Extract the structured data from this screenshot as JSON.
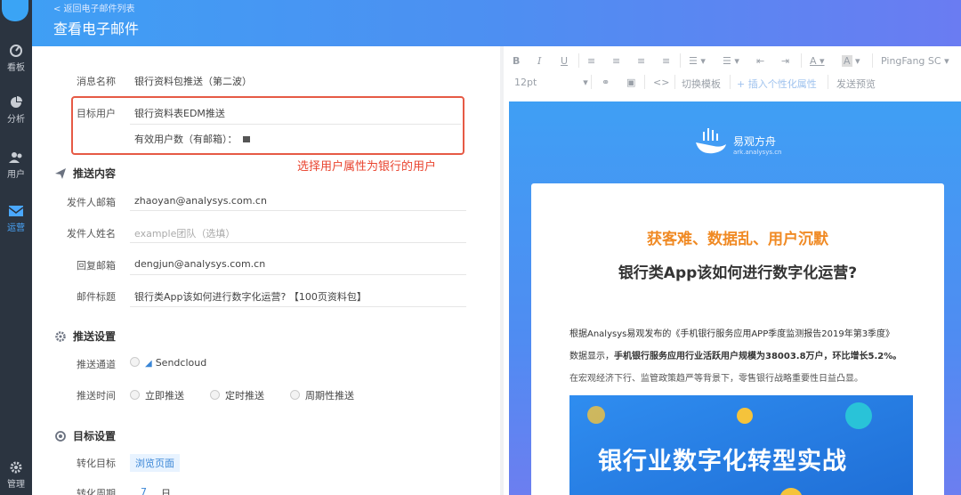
{
  "nav": {
    "items": [
      {
        "label": "看板",
        "icon": "dashboard-icon"
      },
      {
        "label": "分析",
        "icon": "pie-chart-icon"
      },
      {
        "label": "用户",
        "icon": "users-icon"
      },
      {
        "label": "运营",
        "icon": "mail-icon"
      },
      {
        "label": "管理",
        "icon": "gear-icon"
      }
    ]
  },
  "header": {
    "back_link": "< 返回电子邮件列表",
    "title": "查看电子邮件"
  },
  "form": {
    "message_name_label": "消息名称",
    "message_name_value": "银行资料包推送（第二波）",
    "target_users_label": "目标用户",
    "target_users_value": "银行资料表EDM推送",
    "valid_users_label": "有效用户数（有邮箱）：",
    "annotation": "选择用户属性为银行的用户",
    "push_content_title": "推送内容",
    "sender_email_label": "发件人邮箱",
    "sender_email_value": "zhaoyan@analysys.com.cn",
    "sender_name_label": "发件人姓名",
    "sender_name_placeholder": "example团队（选填）",
    "reply_email_label": "回复邮箱",
    "reply_email_value": "dengjun@analysys.com.cn",
    "subject_label": "邮件标题",
    "subject_value": "银行类App该如何进行数字化运营? 【100页资料包】",
    "push_settings_title": "推送设置",
    "channel_label": "推送通道",
    "channel_value": "Sendcloud",
    "time_label": "推送时间",
    "time_options": [
      "立即推送",
      "定时推送",
      "周期性推送"
    ],
    "target_settings_title": "目标设置",
    "conversion_target_label": "转化目标",
    "conversion_target_value": "浏览页面",
    "conversion_period_label": "转化周期",
    "conversion_period_value": "7",
    "conversion_period_unit": "日"
  },
  "editor": {
    "toolbar": {
      "bold": "B",
      "italic": "I",
      "underline": "U",
      "font_family": "PingFang SC",
      "font_size": "12pt",
      "switch_template": "切换模板",
      "insert_attr": "+ 插入个性化属性",
      "send_preview": "发送预览",
      "code": "<>"
    },
    "preview": {
      "brand_name": "易观方舟",
      "brand_url": "ark.analysys.cn",
      "headline": "获客难、数据乱、用户沉默",
      "subheadline": "银行类App该如何进行数字化运营?",
      "para1": "根据Analysys易观发布的《手机银行服务应用APP季度监测报告2019年第3季度》",
      "para2_prefix": "数据显示，",
      "para2_bold": "手机银行服务应用行业活跃用户规模为38003.8万户，环比增长5.2%。",
      "para3": "在宏观经济下行、监管政策趋严等背景下，零售银行战略重要性日益凸显。",
      "banner_title": "银行业数字化转型实战"
    }
  },
  "colors": {
    "header_start": "#3f9ff4",
    "header_end": "#6a7cf2",
    "nav_bg": "#2b3440",
    "highlight_red": "#e65a45",
    "headline_orange": "#f08a24"
  }
}
